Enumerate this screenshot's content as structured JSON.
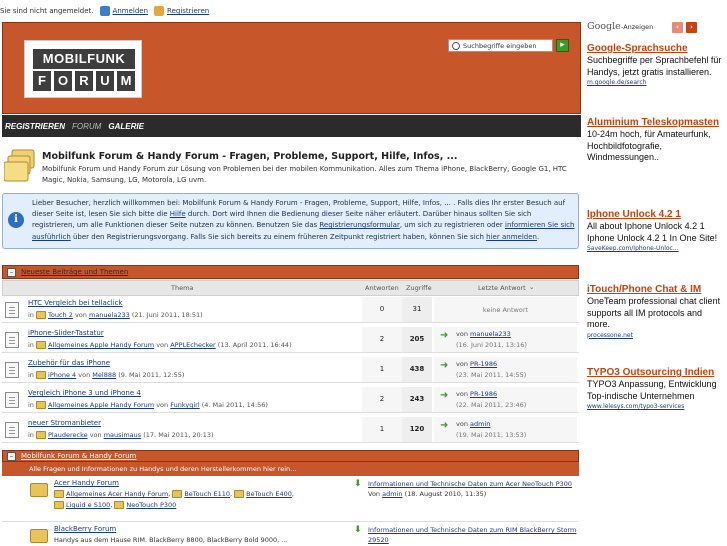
{
  "topbar": {
    "status": "Sie sind nicht angemeldet.",
    "login": "Anmelden",
    "register": "Registrieren"
  },
  "logo": {
    "line1": "MOBILFUNK",
    "letters": [
      "F",
      "O",
      "R",
      "U",
      "M"
    ]
  },
  "search": {
    "placeholder": "Suchbegriffe eingeben",
    "go": "▸"
  },
  "nav": {
    "items": [
      "REGISTRIEREN",
      "FORUM",
      "GALERIE"
    ]
  },
  "intro": {
    "title": "Mobilfunk Forum & Handy Forum - Fragen, Probleme, Support, Hilfe, Infos, ...",
    "text": "Mobilfunk Forum und Handy Forum zur Lösung von Problemen bei der mobilen Kommunikation. Alles zum Thema iPhone, BlackBerry, Google G1, HTC Magic, Nokia, Samsung, LG, Motorola, LG uvm."
  },
  "welcome": {
    "p1": "Lieber Besucher, herzlich willkommen bei: Mobilfunk Forum & Handy Forum - Fragen, Probleme, Support, Hilfe, Infos, ... . Falls dies Ihr erster Besuch auf dieser Seite ist, lesen Sie sich bitte die ",
    "help": "Hilfe",
    "p2": " durch. Dort wird Ihnen die Bedienung dieser Seite näher erläutert. Darüber hinaus sollten Sie sich registrieren, um alle Funktionen dieser Seite nutzen zu können. Benutzen Sie das ",
    "form": "Registrierungsformular",
    "p3": ", um sich zu registrieren oder ",
    "info": "informieren Sie sich ausführlich",
    "p4": " über den Registrierungsvorgang. Falls Sie sich bereits zu einem früheren Zeitpunkt registriert haben, können Sie sich ",
    "login": "hier anmelden",
    "p5": "."
  },
  "latest": {
    "header": "Neueste Beiträge und Themen",
    "cols": {
      "topic": "Thema",
      "replies": "Antworten",
      "views": "Zugriffe",
      "last": "Letzte Antwort"
    },
    "in": "in",
    "von": "von",
    "rows": [
      {
        "title": "HTC Vergleich bei tellaclick",
        "forum": "Touch 2",
        "author": "manuela233",
        "date": "(21. Juni 2011, 18:51)",
        "replies": "0",
        "views": "31",
        "last_none": "keine Antwort",
        "last_by": "",
        "last_date": ""
      },
      {
        "title": "iPhone-Slider-Tastatur",
        "forum": "Allgemeines Apple Handy Forum",
        "author": "APPLEchecker",
        "date": "(13. April 2011, 16:44)",
        "replies": "2",
        "views": "205",
        "last_none": "",
        "last_by": "manuela233",
        "last_date": "(16. Juni 2011, 13:16)"
      },
      {
        "title": "Zubehör für das iPhone",
        "forum": "iPhone 4",
        "author": "Mel888",
        "date": "(9. Mai 2011, 12:55)",
        "replies": "1",
        "views": "438",
        "last_none": "",
        "last_by": "PR-1986",
        "last_date": "(23. Mai 2011, 14:55)"
      },
      {
        "title": "Vergleich iPhone 3 und iPhone 4",
        "forum": "Allgemeines Apple Handy Forum",
        "author": "Funkygirl",
        "date": "(4. Mai 2011, 14:56)",
        "replies": "2",
        "views": "243",
        "last_none": "",
        "last_by": "PR-1986",
        "last_date": "(22. Mai 2011, 23:46)"
      },
      {
        "title": "neuer Stromanbieter",
        "forum": "Plauderecke",
        "author": "mausimaus",
        "date": "(17. Mai 2011, 20:13)",
        "replies": "1",
        "views": "120",
        "last_none": "",
        "last_by": "admin",
        "last_date": "(19. Mai 2011, 13:53)"
      }
    ]
  },
  "boards": {
    "header": "Mobilfunk Forum & Handy Forum",
    "desc": "Alle Fragen und Informationen zu Handys und deren Herstellerkommen hier rein...",
    "acer": {
      "title": "Acer Handy Forum",
      "sub1": "Allgemeines Acer Handy Forum",
      "sub2": "BeTouch E110",
      "sub3": "BeTouch E400",
      "sub4": "Liquid e S100",
      "sub5": "NeoTouch P300",
      "last": "Informationen und Technische Daten zum Acer NeoTouch P300",
      "last_von": "Von",
      "last_by": "admin",
      "last_date": "(18. August 2010, 11:35)"
    },
    "bb": {
      "title": "BlackBerry Forum",
      "desc": "Handys aus dem Hause RIM. BlackBerry 8800, BlackBerry Bold 9000, ...",
      "last": "Informationen und Technische Daten zum RIM BlackBerry Storm 29520"
    }
  },
  "ads": {
    "google": "Google",
    "label": "-Anzeigen",
    "prev": "‹",
    "next": "›",
    "items": [
      {
        "title": "Google-Sprachsuche",
        "body": "Suchbegriffe per Sprachbefehl für Handys, jetzt gratis installieren.",
        "url": "m.google.de/search"
      },
      {
        "title": "Aluminium Teleskopmasten",
        "body": "10-24m hoch, für Amateurfunk, Hochbildfotografie, Windmessungen..",
        "url": ""
      },
      {
        "title": "Iphone Unlock 4.2 1",
        "body": "All about Iphone Unlock 4.2 1 Iphone Unlock 4.2 1 In One Site!",
        "url": "SaveKeep.com/Iphone-Unloc..."
      },
      {
        "title": "iTouch/Phone Chat & IM",
        "body": "OneTeam professional chat client supports all IM protocols and more.",
        "url": "processone.net"
      },
      {
        "title": "TYPO3 Outsourcing Indien",
        "body": "TYPO3 Anpassung, Entwicklung Top-indische Unternehmen",
        "url": "www.lelesys.com/typo3-services"
      }
    ]
  },
  "colors": {
    "header": "#c7572a",
    "nav": "#2b2b2b",
    "ad_title": "#c8420f"
  }
}
